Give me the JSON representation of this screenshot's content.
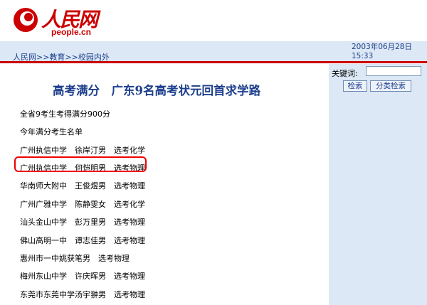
{
  "logo": {
    "brand_cn": "人民网",
    "brand_en": "people.cn"
  },
  "breadcrumb": {
    "home": "人民网",
    "sep1": ">>",
    "section": "教育",
    "sep2": ">>",
    "current": "校园内外"
  },
  "datetime": {
    "date": "2003年06月28日",
    "time": "15:33"
  },
  "search": {
    "label": "关键词:",
    "value": "",
    "search_button": "检索",
    "category_button": "分类检索"
  },
  "article": {
    "title": "高考满分　广东9名高考状元回首求学路",
    "intro1": "全省9考生考得满分900分",
    "intro2": "今年满分考生名单",
    "students": [
      "广州执信中学　徐岸汀男　选考化学",
      "广州执信中学　何恺明男　选考物理",
      "华南师大附中　王俊煜男　选考物理",
      "广州广雅中学　陈静雯女　选考化学",
      "汕头金山中学　彭万里男　选考物理",
      "佛山高明一中　谭志佳男　选考物理",
      "惠州市一中姚获笔男　选考物理",
      "梅州东山中学　许庆晖男　选考物理",
      "东莞市东莞中学汤宇翀男　选考物理"
    ]
  },
  "colors": {
    "brand_red": "#cc0000",
    "nav_blue": "#dce8f5",
    "link_blue": "#1d3f8c",
    "highlight": "#ee0000"
  }
}
